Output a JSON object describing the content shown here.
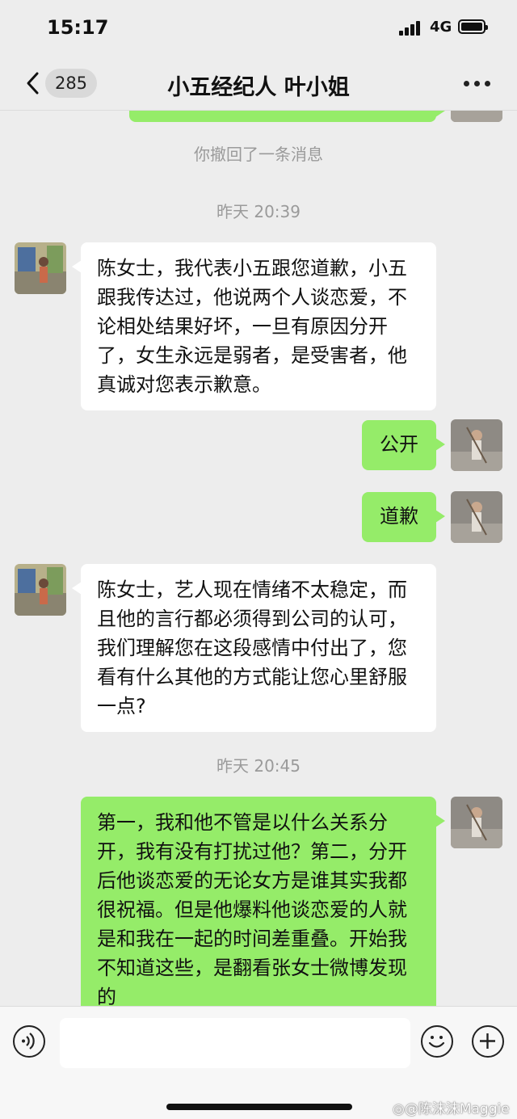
{
  "status": {
    "time": "15:17",
    "network": "4G"
  },
  "nav": {
    "back_count": "285",
    "title": "小五经纪人 叶小姐"
  },
  "messages": {
    "recalled": "你撤回了一条消息",
    "time1": "昨天 20:39",
    "m1": "陈女士，我代表小五跟您道歉，小五跟我传达过，他说两个人谈恋爱，不论相处结果好坏，一旦有原因分开了，女生永远是弱者，是受害者，他真诚对您表示歉意。",
    "m2": "公开",
    "m3": "道歉",
    "m4": "陈女士，艺人现在情绪不太稳定，而且他的言行都必须得到公司的认可，我们理解您在这段感情中付出了，您看有什么其他的方式能让您心里舒服一点?",
    "time2": "昨天 20:45",
    "m5": "第一，我和他不管是以什么关系分开，我有没有打扰过他？第二，分开后他谈恋爱的无论女方是谁其实我都很祝福。但是他爆料他谈恋爱的人就是和我在一起的时间差重叠。开始我不知道这些，是翻看张女士微博发现的"
  },
  "watermark": "@陈沫沫Maggie",
  "icons": {
    "back": "chevron-left-icon",
    "more": "more-dots-icon",
    "voice": "voice-icon",
    "emoji": "emoji-icon",
    "plus": "plus-icon",
    "weibo": "weibo-logo-icon"
  },
  "colors": {
    "background": "#ededed",
    "self_bubble": "#95ec69",
    "other_bubble": "#ffffff"
  }
}
